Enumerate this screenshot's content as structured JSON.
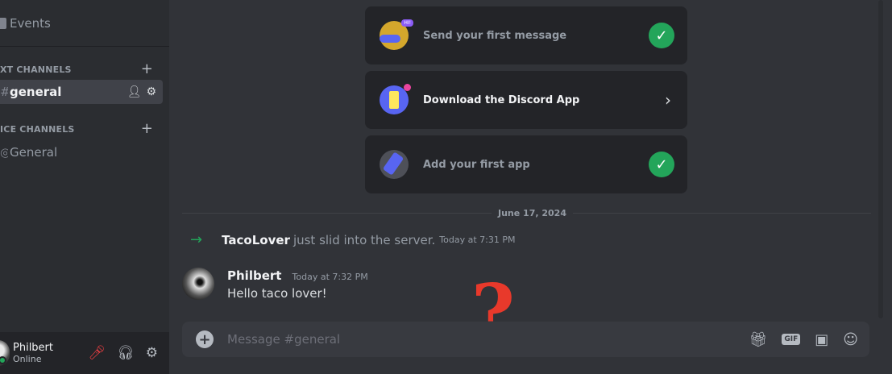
{
  "sidebar": {
    "events_label": "Events",
    "text_category": "XT CHANNELS",
    "voice_category": "ICE CHANNELS",
    "text_channel": "general",
    "voice_channel": "General",
    "hash_glyph": "#",
    "voice_glyph": "◎"
  },
  "user": {
    "name": "Philbert",
    "status": "Online"
  },
  "onboarding": [
    {
      "title": "Send your first message",
      "state": "done",
      "icon": "message-icon",
      "badge": "HI!"
    },
    {
      "title": "Download the Discord App",
      "state": "active",
      "icon": "phone-icon"
    },
    {
      "title": "Add your first app",
      "state": "done",
      "icon": "wrench-icon"
    }
  ],
  "date_divider": "June 17, 2024",
  "join": {
    "user": "TacoLover",
    "text": "just slid into the server.",
    "timestamp": "Today at 7:31 PM"
  },
  "message": {
    "author": "Philbert",
    "timestamp": "Today at 7:32 PM",
    "text": "Hello taco lover!"
  },
  "overlay": {
    "question_mark": "?"
  },
  "composer": {
    "placeholder": "Message #general",
    "gif_label": "GIF"
  },
  "colors": {
    "accent": "#5865f2",
    "success": "#23a55a",
    "danger": "#f23f43",
    "overlay": "#e8392b"
  }
}
